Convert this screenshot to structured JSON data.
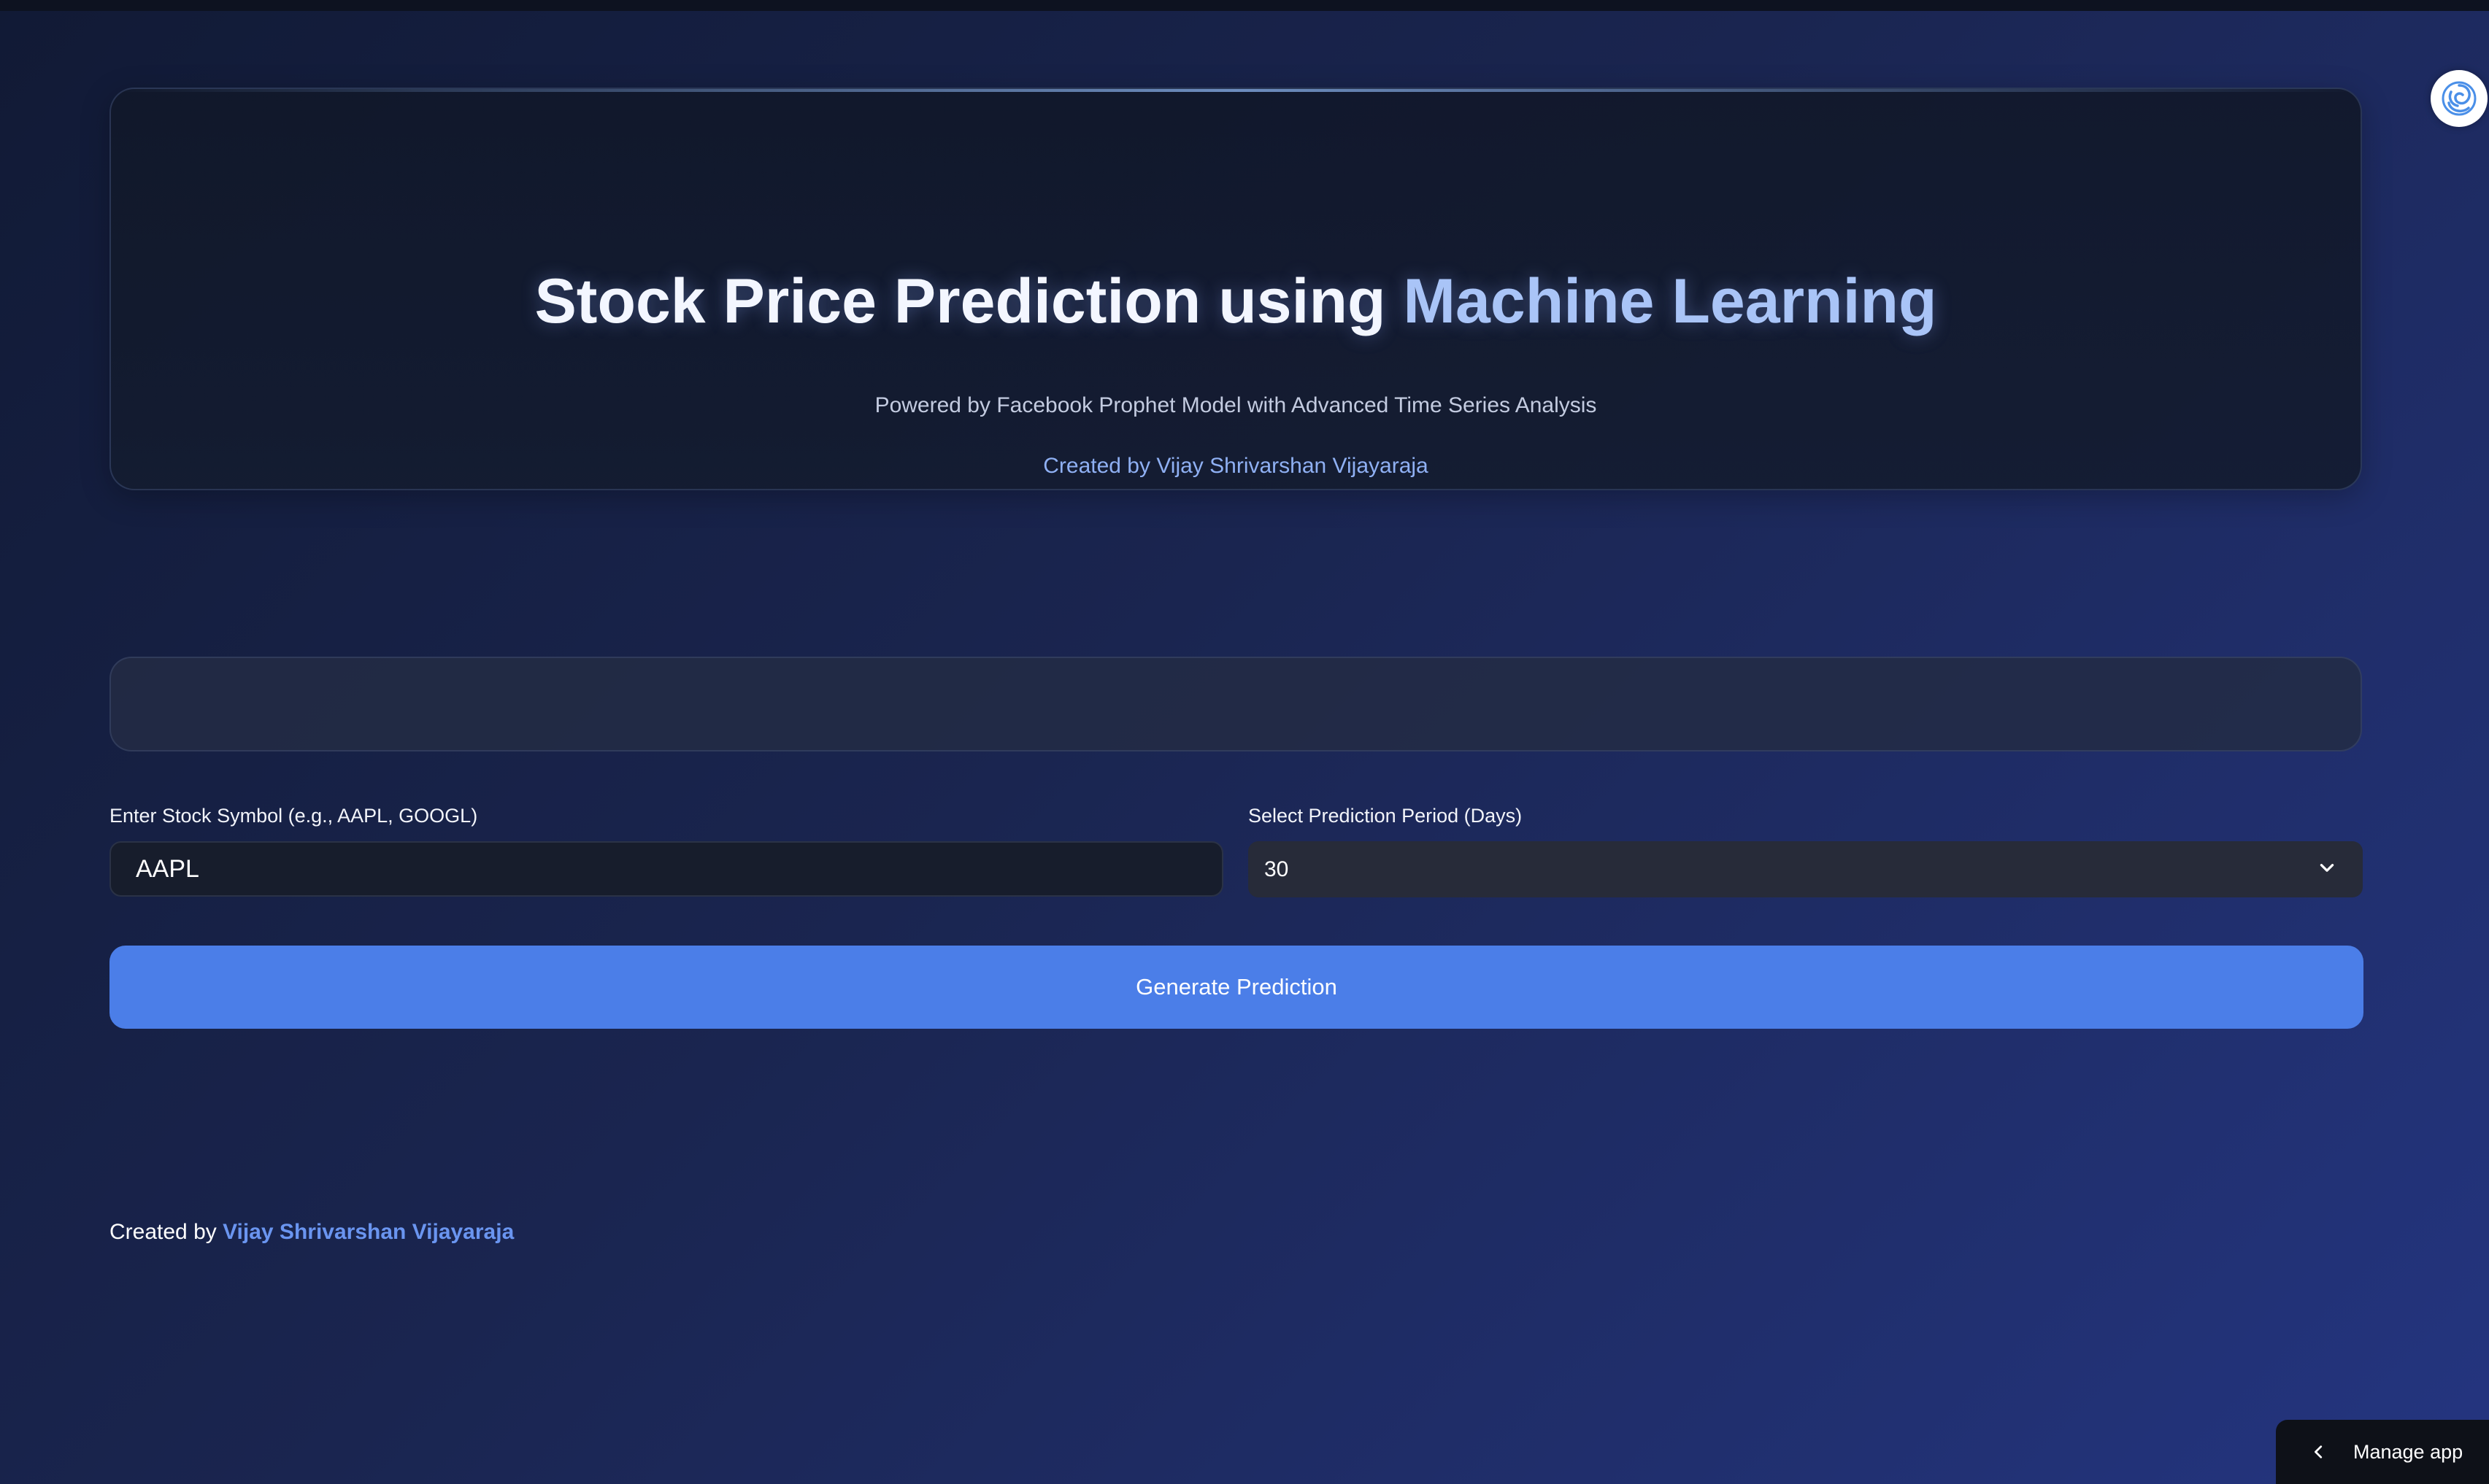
{
  "hero": {
    "title_main": "Stock Price Prediction using ",
    "title_highlight": "Machine Learning",
    "subtitle": "Powered by Facebook Prophet Model with Advanced Time Series Analysis",
    "credit": "Created by Vijay Shrivarshan Vijayaraja"
  },
  "form": {
    "symbol_label": "Enter Stock Symbol (e.g., AAPL, GOOGL)",
    "symbol_value": "AAPL",
    "period_label": "Select Prediction Period (Days)",
    "period_value": "30",
    "generate_label": "Generate Prediction"
  },
  "footer": {
    "prefix": "Created by ",
    "author": "Vijay Shrivarshan Vijayaraja"
  },
  "manage": {
    "label": "Manage app"
  },
  "icons": {
    "avatar": "swirl-logo-icon",
    "chevron": "chevron-down-icon",
    "back": "chevron-left-icon"
  },
  "colors": {
    "accent": "#4b7ee8",
    "highlight": "#a9c4f7",
    "link": "#6a95f0"
  }
}
